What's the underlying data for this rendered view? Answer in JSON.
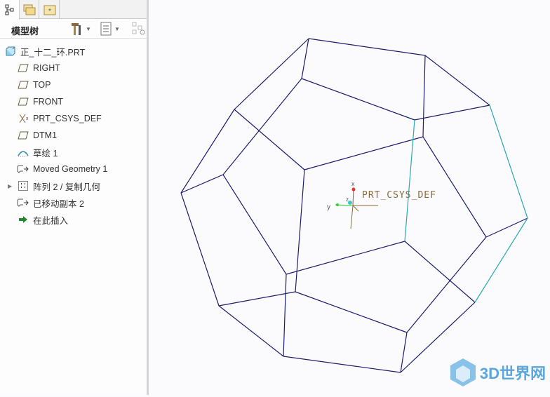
{
  "tabs": [
    {
      "icon": "model-tree-icon"
    },
    {
      "icon": "folder-browser-icon"
    },
    {
      "icon": "favorites-folder-icon"
    }
  ],
  "panel": {
    "title": "模型树",
    "tools": [
      {
        "icon": "settings-tools-icon"
      },
      {
        "icon": "show-list-icon"
      },
      {
        "icon": "tree-filter-icon"
      }
    ]
  },
  "tree": {
    "root": "正_十二_环.PRT",
    "items": [
      {
        "label": "RIGHT",
        "icon": "datum-plane-icon"
      },
      {
        "label": "TOP",
        "icon": "datum-plane-icon"
      },
      {
        "label": "FRONT",
        "icon": "datum-plane-icon"
      },
      {
        "label": "PRT_CSYS_DEF",
        "icon": "coordinate-system-icon"
      },
      {
        "label": "DTM1",
        "icon": "datum-plane-icon"
      },
      {
        "label": "草绘 1",
        "icon": "sketch-icon"
      },
      {
        "label": "Moved Geometry 1",
        "icon": "moved-geometry-icon"
      },
      {
        "label": "阵列 2 / 复制几何",
        "icon": "pattern-icon",
        "expandable": true
      },
      {
        "label": "已移动副本 2",
        "icon": "moved-geometry-icon"
      },
      {
        "label": "在此插入",
        "icon": "insert-here-arrow-icon"
      }
    ]
  },
  "viewport": {
    "csys_label": "PRT_CSYS_DEF",
    "axis_x": "x",
    "axis_y": "y",
    "axis_z": "z",
    "edge_color": "#1c1c6e",
    "hidden_edge_color": "#2aa7b3"
  },
  "watermark": {
    "text": "3D世界网"
  }
}
